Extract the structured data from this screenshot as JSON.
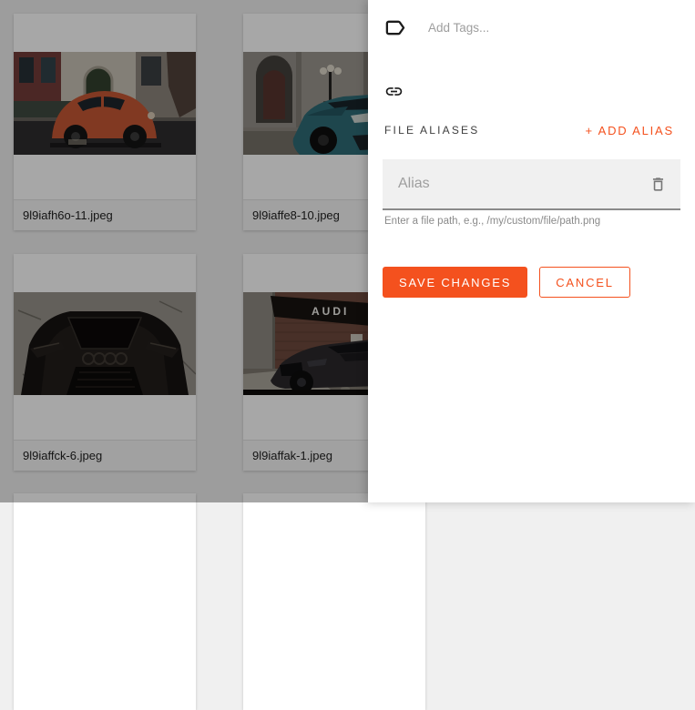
{
  "colors": {
    "accent": "#F4511E",
    "overlay": "rgba(0,0,0,0.345)"
  },
  "panel": {
    "tags": {
      "placeholder": "Add Tags...",
      "icon": "tag-icon"
    },
    "link_icon": "link-icon",
    "file_aliases": {
      "title": "FILE ALIASES",
      "add_button_label": "+ ADD ALIAS",
      "alias_input": {
        "placeholder": "Alias",
        "value": ""
      },
      "delete_icon": "trash-icon",
      "helper_text": "Enter a file path, e.g., /my/custom/file/path.png"
    },
    "buttons": {
      "save_label": "SAVE CHANGES",
      "cancel_label": "CANCEL"
    }
  },
  "grid": {
    "files": [
      {
        "name": "9l9iafh6o-11.jpeg",
        "thumbnail": "orange-beetle-street-photo"
      },
      {
        "name": "9l9iaffe8-10.jpeg",
        "thumbnail": "teal-bmw-building-photo"
      },
      {
        "name": "9l9iaffck-6.jpeg",
        "thumbnail": "black-audi-hood-photo"
      },
      {
        "name": "9l9iaffak-1.jpeg",
        "thumbnail": "dark-audi-dealership-photo",
        "image_text": "AUDI"
      }
    ]
  }
}
